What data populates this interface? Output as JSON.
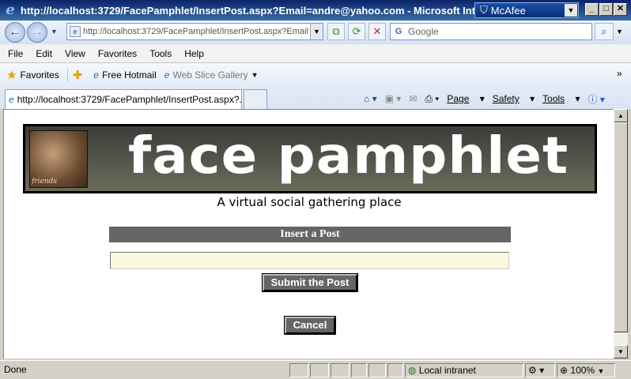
{
  "window": {
    "title": "http://localhost:3729/FacePamphlet/InsertPost.aspx?Email=andre@yahoo.com - Microsoft Internet Explorer",
    "mcafee_label": "McAfee",
    "minimize": "_",
    "maximize": "□",
    "close": "✕"
  },
  "address_bar": {
    "url": "http://localhost:3729/FacePamphlet/InsertPost.aspx?Email",
    "search_placeholder": "Google"
  },
  "menu": [
    "File",
    "Edit",
    "View",
    "Favorites",
    "Tools",
    "Help"
  ],
  "favorites_bar": {
    "favorites_label": "Favorites",
    "items": [
      "Free Hotmail",
      "Web Slice Gallery"
    ]
  },
  "tabs": {
    "active_tab": "http://localhost:3729/FacePamphlet/InsertPost.aspx?..."
  },
  "command_bar": {
    "page": "Page",
    "safety": "Safety",
    "tools": "Tools"
  },
  "page": {
    "logo_text": "face pamphlet",
    "photo_caption": "friends",
    "tagline": "A virtual social gathering place",
    "heading": "Insert a Post",
    "post_value": "",
    "submit_label": "Submit the Post",
    "cancel_label": "Cancel"
  },
  "status_bar": {
    "status": "Done",
    "zone": "Local intranet",
    "zoom": "100%"
  },
  "colors": {
    "heading_bg": "#656565",
    "input_bg": "#f8f7e0",
    "banner_bg": "#3a3d3a"
  }
}
